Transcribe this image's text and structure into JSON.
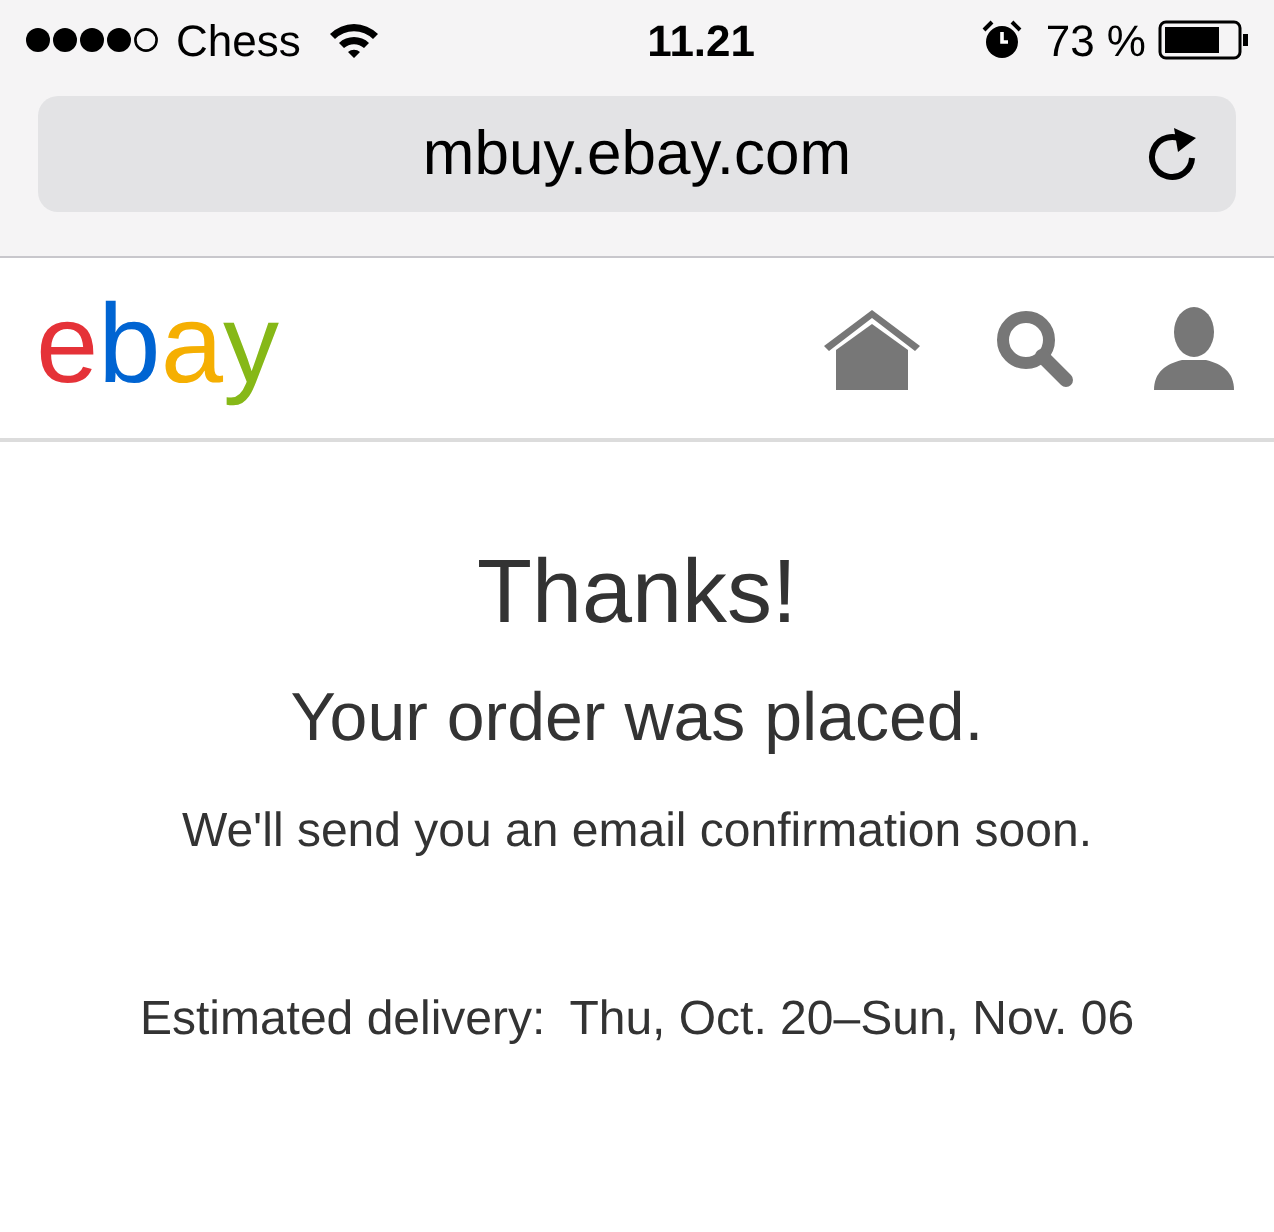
{
  "status_bar": {
    "carrier": "Chess",
    "time": "11.21",
    "battery": "73 %"
  },
  "address_bar": {
    "url": "mbuy.ebay.com"
  },
  "header": {
    "logo": [
      {
        "letter": "e",
        "color": "#e53238"
      },
      {
        "letter": "b",
        "color": "#0064d2"
      },
      {
        "letter": "a",
        "color": "#f5af02"
      },
      {
        "letter": "y",
        "color": "#86b817"
      }
    ]
  },
  "confirmation": {
    "title": "Thanks!",
    "subtitle": "Your order was placed.",
    "message": "We'll send you an email confirmation soon.",
    "delivery_label": "Estimated delivery:",
    "delivery_dates": "Thu, Oct. 20–Sun, Nov. 06"
  }
}
